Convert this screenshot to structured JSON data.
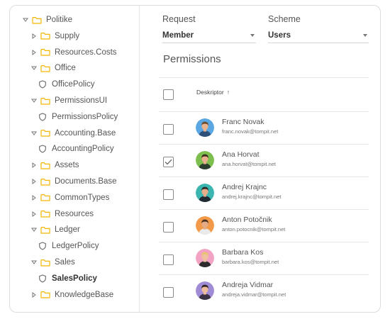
{
  "tree": [
    {
      "label": "Politike",
      "type": "folder",
      "expanded": true,
      "level": 0
    },
    {
      "label": "Supply",
      "type": "folder",
      "expanded": false,
      "level": 1
    },
    {
      "label": "Resources.Costs",
      "type": "folder",
      "expanded": false,
      "level": 1
    },
    {
      "label": "Office",
      "type": "folder",
      "expanded": true,
      "level": 1
    },
    {
      "label": "OfficePolicy",
      "type": "policy",
      "level": 2
    },
    {
      "label": "PermissionsUI",
      "type": "folder",
      "expanded": true,
      "level": 1
    },
    {
      "label": "PermissionsPolicy",
      "type": "policy",
      "level": 2
    },
    {
      "label": "Accounting.Base",
      "type": "folder",
      "expanded": true,
      "level": 1
    },
    {
      "label": "AccountingPolicy",
      "type": "policy",
      "level": 2
    },
    {
      "label": "Assets",
      "type": "folder",
      "expanded": false,
      "level": 1
    },
    {
      "label": "Documents.Base",
      "type": "folder",
      "expanded": false,
      "level": 1
    },
    {
      "label": "CommonTypes",
      "type": "folder",
      "expanded": false,
      "level": 1
    },
    {
      "label": "Resources",
      "type": "folder",
      "expanded": false,
      "level": 1
    },
    {
      "label": "Ledger",
      "type": "folder",
      "expanded": true,
      "level": 1
    },
    {
      "label": "LedgerPolicy",
      "type": "policy",
      "level": 2
    },
    {
      "label": "Sales",
      "type": "folder",
      "expanded": true,
      "level": 1
    },
    {
      "label": "SalesPolicy",
      "type": "policy",
      "level": 2,
      "selected": true
    },
    {
      "label": "KnowledgeBase",
      "type": "folder",
      "expanded": false,
      "level": 1
    }
  ],
  "request": {
    "label": "Request",
    "value": "Member"
  },
  "scheme": {
    "label": "Scheme",
    "value": "Users"
  },
  "permissions": {
    "title": "Permissions",
    "column_header": "Deskriptor",
    "sort": "ascending"
  },
  "users": [
    {
      "name": "Franc Novak",
      "email": "franc.novak@tompit.net",
      "checked": false,
      "avatar_bg": "#5aa7e3",
      "skin": "#e9b48f",
      "hair": "#6b4a2e",
      "shirt": "#2e4f77"
    },
    {
      "name": "Ana Horvat",
      "email": "ana.horvat@tompit.net",
      "checked": true,
      "avatar_bg": "#7cbf4e",
      "skin": "#e8b08a",
      "hair": "#3b2a1d",
      "shirt": "#2b3e2e"
    },
    {
      "name": "Andrej Krajnc",
      "email": "andrej.krajnc@tompit.net",
      "checked": false,
      "avatar_bg": "#3bb5b0",
      "skin": "#e6ad88",
      "hair": "#2d2b2a",
      "shirt": "#1f2a33"
    },
    {
      "name": "Anton Potočnik",
      "email": "anton.potocnik@tompit.net",
      "checked": false,
      "avatar_bg": "#f39a4a",
      "skin": "#e4ab86",
      "hair": "#4a3322",
      "shirt": "#eaeaea"
    },
    {
      "name": "Barbara Kos",
      "email": "barbara.kos@tompit.net",
      "checked": false,
      "avatar_bg": "#f2a3c3",
      "skin": "#f0c19f",
      "hair": "#e8c46a",
      "shirt": "#2c2c2c"
    },
    {
      "name": "Andreja Vidmar",
      "email": "andreja.vidmar@tompit.net",
      "checked": false,
      "avatar_bg": "#a08bd6",
      "skin": "#edbc9c",
      "hair": "#2e2320",
      "shirt": "#3a3242"
    }
  ],
  "colors": {
    "folder": "#f2b705",
    "check": "#666666",
    "divider": "#e8e8e8"
  }
}
